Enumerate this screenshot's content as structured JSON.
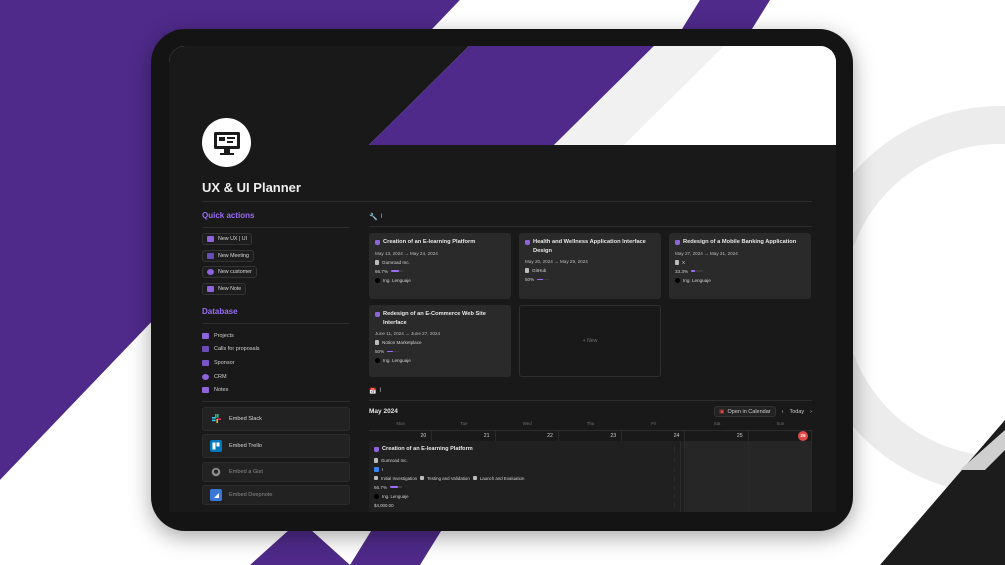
{
  "page": {
    "title": "UX & UI Planner"
  },
  "quick_actions": {
    "heading": "Quick actions",
    "buttons": [
      "New UX | UI",
      "New Meeting",
      "New customer",
      "New Note"
    ]
  },
  "database": {
    "heading": "Database",
    "items": [
      "Projects",
      "Calls for proposals",
      "Sponsor",
      "CRM",
      "Notes"
    ]
  },
  "embeds": [
    "Embed Slack",
    "Embed Trello",
    "Embed a Gist",
    "Embed Deepnote"
  ],
  "gallery": {
    "tab_label": "I",
    "new_label": "+ New",
    "cards": [
      {
        "title": "Creation of an E-learning Platform",
        "dates": "May 13, 2024 → May 24, 2024",
        "client": "Gumroad Inc.",
        "progress": "66.7%",
        "progress_value": 0.667,
        "owner": "Ing. Lenguaje"
      },
      {
        "title": "Health and Wellness Application Interface Design",
        "dates": "May 20, 2024 → May 29, 2024",
        "client": "GitHub",
        "progress": "50%",
        "progress_value": 0.5,
        "owner": ""
      },
      {
        "title": "Redesign of a Mobile Banking Application",
        "dates": "May 27, 2024 → May 31, 2024",
        "client": "X",
        "progress": "33.3%",
        "progress_value": 0.333,
        "owner": "Ing. Lenguaje"
      },
      {
        "title": "Redesign of an E-Commerce Web Site Interface",
        "dates": "June 11, 2024 → June 27, 2024",
        "client": "Notion Marketplace",
        "progress": "50%",
        "progress_value": 0.5,
        "owner": "Ing. Lenguaje"
      }
    ]
  },
  "calendar": {
    "tab_label": "I",
    "month": "May 2024",
    "open_label": "Open in Calendar",
    "today_label": "Today",
    "weekdays": [
      "Mon",
      "Tue",
      "Wed",
      "Thu",
      "Fri",
      "Sat",
      "Sun"
    ],
    "days": [
      "20",
      "21",
      "22",
      "23",
      "24",
      "25",
      "26"
    ],
    "event": {
      "title": "Creation of an E-learning Platform",
      "client": "Gumroad Inc.",
      "check": "I",
      "phases": [
        "Initial Investigation",
        "Testing and Validation",
        "Launch and Evaluation"
      ],
      "progress": "66.7%",
      "progress_value": 0.667,
      "owner": "Ing. Lenguaje",
      "amount": "$4,000.00"
    }
  },
  "colors": {
    "accent": "#9b6cf5",
    "brand_purple": "#4f2a8a",
    "today": "#e04848"
  }
}
